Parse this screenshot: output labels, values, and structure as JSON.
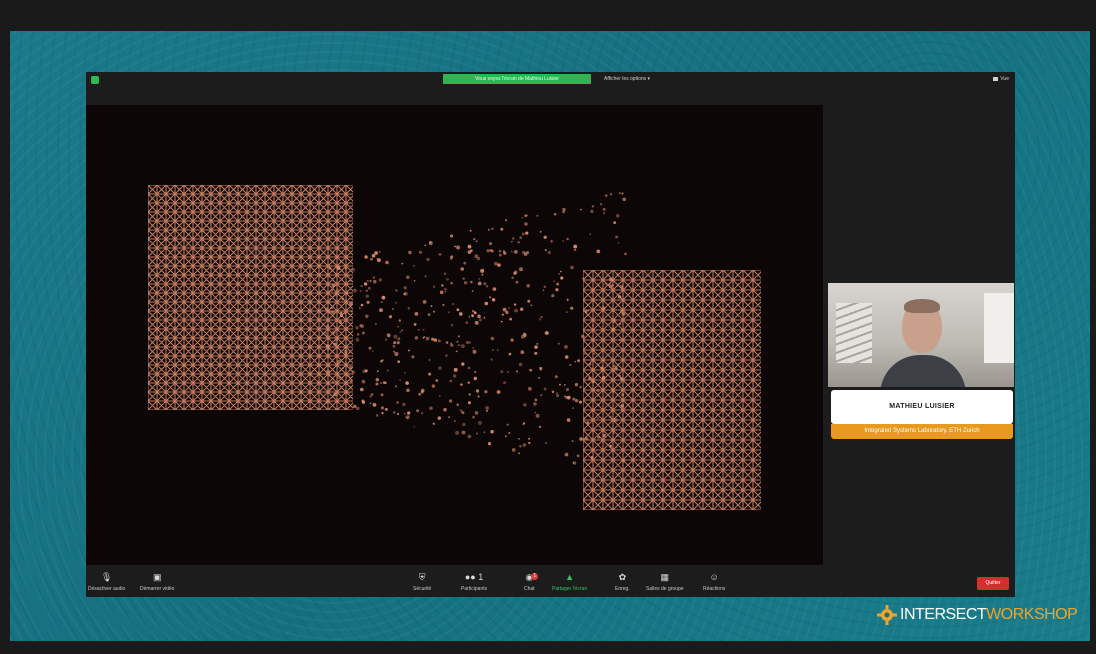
{
  "meeting": {
    "share_banner": "Vous voyez l'écran de Mathieu Luisier",
    "annotate_label": "Afficher les options",
    "view_label": "Vue"
  },
  "speaker": {
    "name": "MATHIEU LUISIER",
    "affiliation": "Integrated Systems Laboratory, ETH Zurich"
  },
  "toolbar": {
    "audio": "Désactiver audio",
    "video": "Démarrer vidéo",
    "security": "Sécurité",
    "participants": "Participants",
    "participants_count": "1",
    "chat": "Chat",
    "chat_badge": "1",
    "share": "Partager l'écran",
    "record": "Enreg.",
    "breakout": "Salles de groupe",
    "reactions": "Réactions",
    "end": "Quitter"
  },
  "brand": {
    "part1": "INTERSECT",
    "part2": "WORKSHOP",
    "accent": "#f0a52a"
  },
  "colors": {
    "background_teal": "#14707f",
    "share_green": "#2db552",
    "end_red": "#d32f2f",
    "lattice": "#d88a6a"
  },
  "icons": {
    "microphone": "microphone-icon",
    "camera": "video-camera-icon",
    "shield": "shield-icon",
    "participants": "people-icon",
    "chat": "chat-bubble-icon",
    "share": "share-screen-icon",
    "record": "record-icon",
    "breakout": "grid-icon",
    "reactions": "smiley-icon"
  }
}
